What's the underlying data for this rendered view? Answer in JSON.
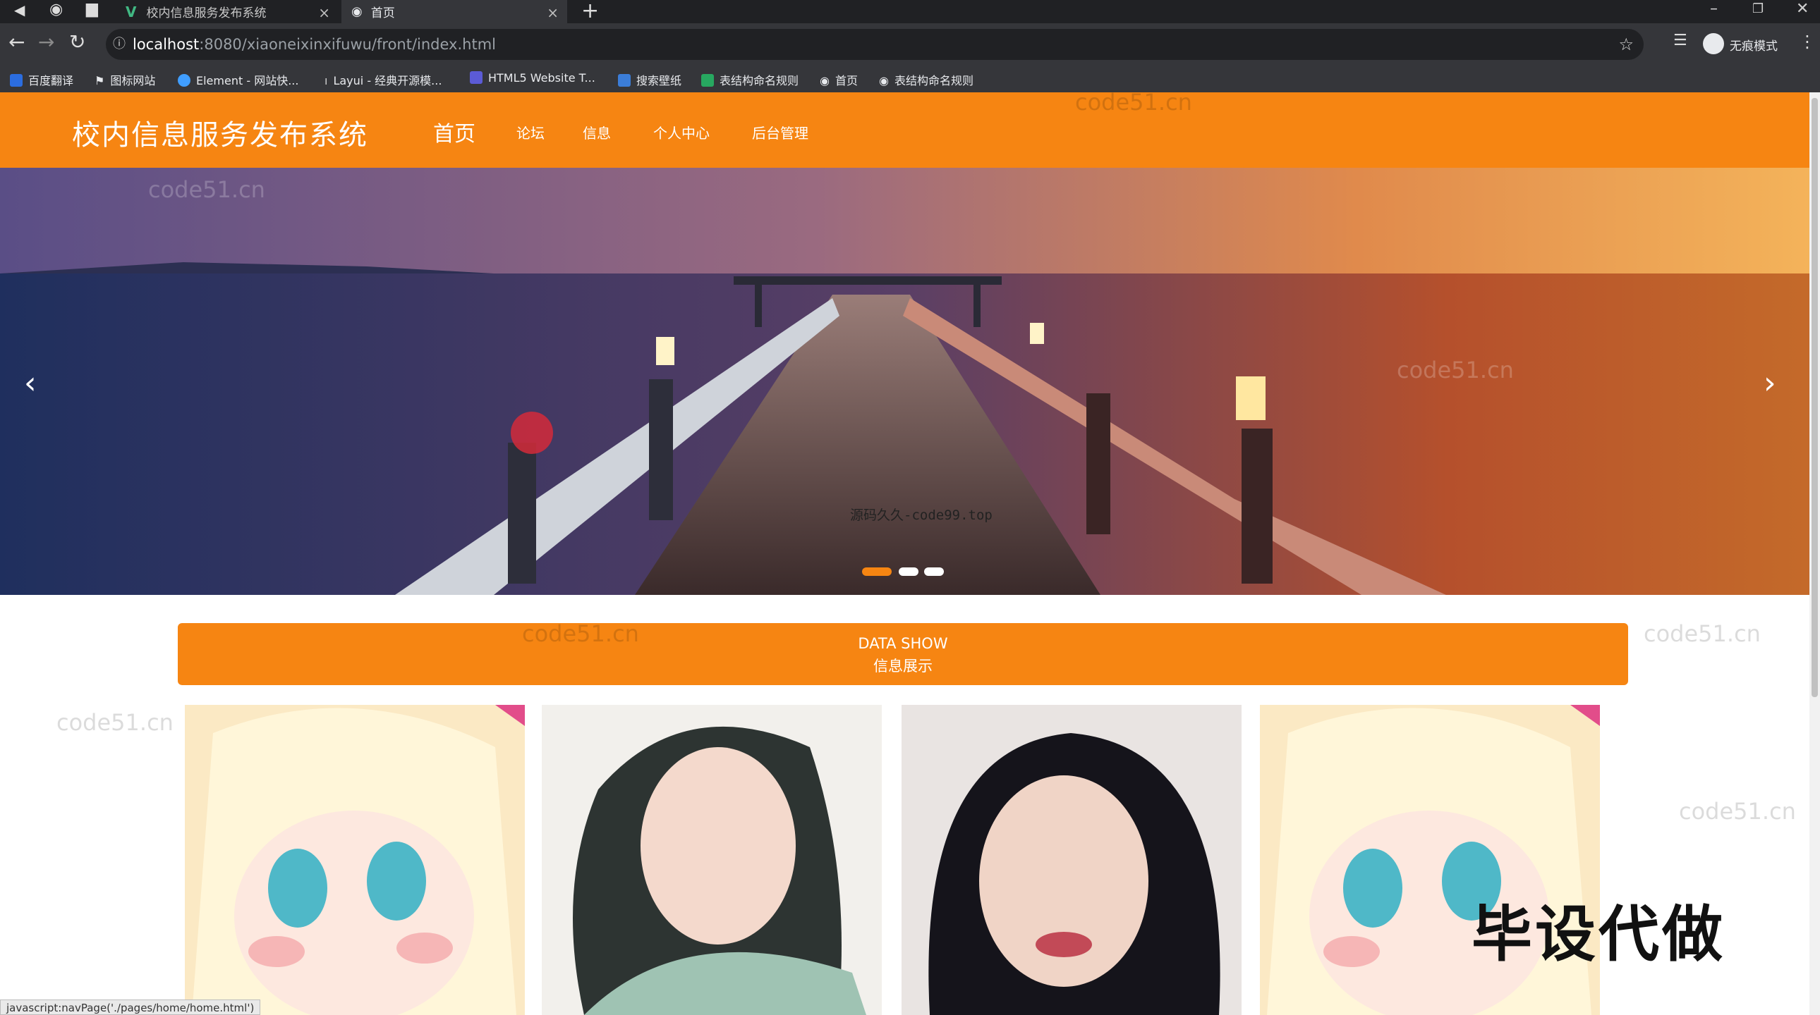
{
  "browser": {
    "tabs": [
      {
        "title": "校内信息服务发布系统"
      },
      {
        "title": "首页"
      }
    ],
    "url": {
      "host": "localhost",
      "path": ":8080/xiaoneixinxifuwu/front/index.html"
    },
    "bookmarks": [
      {
        "label": "百度翻译",
        "icon": "baidu-translate-icon",
        "color": "#2b6de0"
      },
      {
        "label": "图标网站",
        "icon": "flag-icon",
        "color": "#ffffff"
      },
      {
        "label": "Element - 网站快...",
        "icon": "element-icon",
        "color": "#409eff"
      },
      {
        "label": "Layui - 经典开源模...",
        "icon": "layui-icon",
        "color": "#d0d0d0"
      },
      {
        "label": "HTML5 Website T...",
        "icon": "html5-icon",
        "color": "#5b5bd6"
      },
      {
        "label": "搜索壁纸",
        "icon": "wallpaper-icon",
        "color": "#3b7dd8"
      },
      {
        "label": "表结构命名规则",
        "icon": "sheet-icon",
        "color": "#27a860"
      },
      {
        "label": "首页",
        "icon": "globe-icon",
        "color": "#ffffff"
      },
      {
        "label": "表结构命名规则",
        "icon": "globe-icon",
        "color": "#ffffff"
      }
    ],
    "profile_label": "无痕模式"
  },
  "site": {
    "title": "校内信息服务发布系统",
    "nav": [
      {
        "label": "首页"
      },
      {
        "label": "论坛"
      },
      {
        "label": "信息"
      },
      {
        "label": "个人中心"
      },
      {
        "label": "后台管理"
      }
    ],
    "accent_color": "#f68512"
  },
  "carousel": {
    "caption": "源码久久-code99.top",
    "slide_count": 3,
    "active_index": 0
  },
  "data_show": {
    "title_en": "DATA SHOW",
    "title_cn": "信息展示"
  },
  "overlay_text": "毕设代做",
  "watermark": "code51.cn",
  "status_text": "javascript:navPage('./pages/home/home.html')"
}
